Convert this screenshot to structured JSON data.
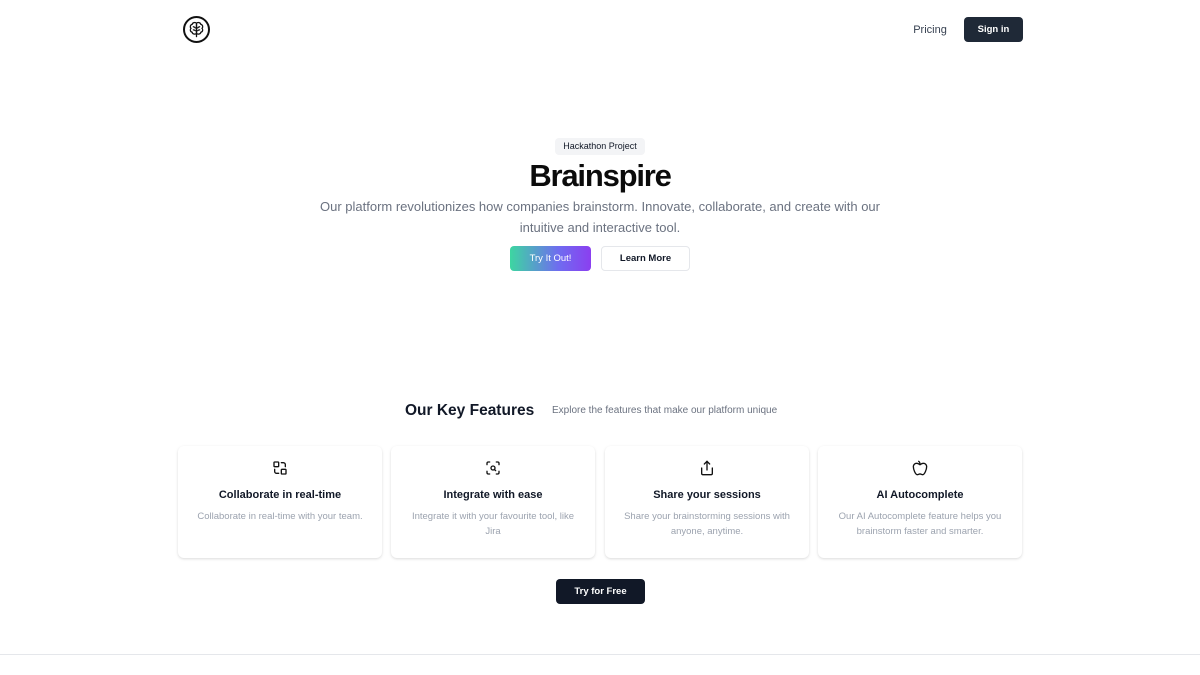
{
  "header": {
    "logo_icon": "brain-icon",
    "nav": {
      "pricing_label": "Pricing"
    },
    "signin_label": "Sign in"
  },
  "hero": {
    "badge": "Hackathon Project",
    "title": "Brainspire",
    "description": "Our platform revolutionizes how companies brainstorm. Innovate, collaborate, and create with our intuitive and interactive tool.",
    "primary_button": "Try It Out!",
    "secondary_button": "Learn More"
  },
  "features": {
    "title": "Our Key Features",
    "subtitle": "Explore the features that make our platform unique",
    "items": [
      {
        "icon": "collaborate-icon",
        "title": "Collaborate in real-time",
        "description": "Collaborate in real-time with your team."
      },
      {
        "icon": "scan-icon",
        "title": "Integrate with ease",
        "description": "Integrate it with your favourite tool, like Jira"
      },
      {
        "icon": "share-icon",
        "title": "Share your sessions",
        "description": "Share your brainstorming sessions with anyone, anytime."
      },
      {
        "icon": "apple-icon",
        "title": "AI Autocomplete",
        "description": "Our AI Autocomplete feature helps you brainstorm faster and smarter."
      }
    ],
    "cta_button": "Try for Free"
  },
  "colors": {
    "primary_dark": "#1f2937",
    "gradient_start": "#3dd6a1",
    "gradient_end": "#8b3ff0",
    "muted_text": "#6b7280"
  }
}
